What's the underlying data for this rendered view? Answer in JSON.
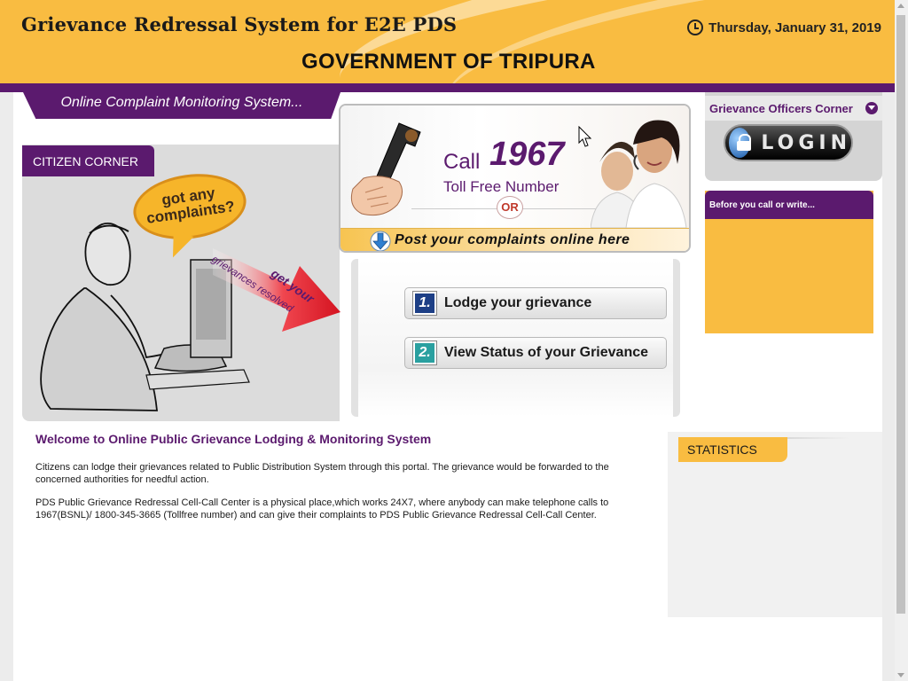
{
  "header": {
    "title": "Grievance Redressal System for E2E PDS",
    "government": "GOVERNMENT OF TRIPURA",
    "date": "Thursday, January 31, 2019"
  },
  "tagline": "Online Complaint Monitoring System...",
  "citizen_corner": {
    "tab_label": "CITIZEN CORNER",
    "bubble_line1": "got any",
    "bubble_line2": "complaints?",
    "arrow_text1": "grievances resolved",
    "arrow_text2": "get your"
  },
  "call_banner": {
    "call_label": "Call",
    "number": "1967",
    "toll_free": "Toll Free Number",
    "or": "OR",
    "post_text": "Post your complaints online here"
  },
  "actions": [
    {
      "num": "1.",
      "label": "Lodge your grievance"
    },
    {
      "num": "2.",
      "label": "View Status of your Grievance"
    }
  ],
  "sidebar": {
    "officers_title": "Grievance Officers Corner",
    "login_label": "LOGIN",
    "before_call_title": "Before you call or write..."
  },
  "welcome": {
    "title": "Welcome to Online Public Grievance Lodging & Monitoring System",
    "para1": "Citizens can lodge their grievances related to Public Distribution System through this portal. The grievance would be forwarded to the concerned authorities for needful action.",
    "para2": "PDS Public Grievance Redressal Cell-Call Center is a physical place,which works 24X7, where anybody can make telephone calls to 1967(BSNL)/ 1800-345-3665 (Tollfree number) and can give their complaints to PDS Public Grievance Redressal Cell-Call Center."
  },
  "statistics": {
    "title": "STATISTICS"
  },
  "colors": {
    "brand_purple": "#5b1a6e",
    "brand_orange": "#f9bc41"
  }
}
